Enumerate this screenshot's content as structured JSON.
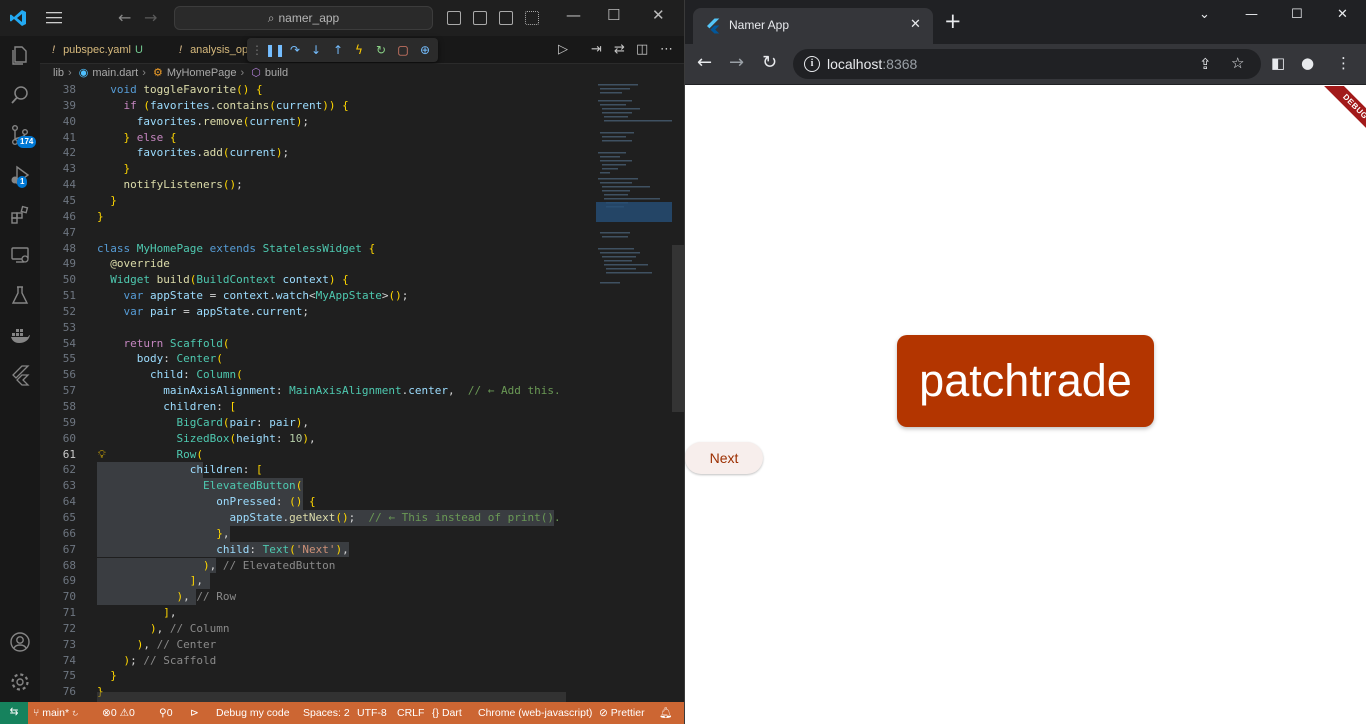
{
  "vscode": {
    "search_text": "namer_app",
    "tabs": [
      {
        "label": "pubspec.yaml",
        "status": "U"
      },
      {
        "label": "analysis_op"
      }
    ],
    "activity_badges": {
      "source_control": "174",
      "run_debug": "1"
    },
    "breadcrumb": [
      "lib",
      "main.dart",
      "MyHomePage",
      "build"
    ],
    "editor": {
      "active_line": 61,
      "code_lines": [
        {
          "num": "38",
          "text": "  void toggleFavorite() {"
        },
        {
          "num": "39",
          "text": "    if (favorites.contains(current)) {"
        },
        {
          "num": "40",
          "text": "      favorites.remove(current);"
        },
        {
          "num": "41",
          "text": "    } else {"
        },
        {
          "num": "42",
          "text": "      favorites.add(current);"
        },
        {
          "num": "43",
          "text": "    }"
        },
        {
          "num": "44",
          "text": "    notifyListeners();"
        },
        {
          "num": "45",
          "text": "  }"
        },
        {
          "num": "46",
          "text": "}"
        },
        {
          "num": "47",
          "text": ""
        },
        {
          "num": "48",
          "text": "class MyHomePage extends StatelessWidget {"
        },
        {
          "num": "49",
          "text": "  @override"
        },
        {
          "num": "50",
          "text": "  Widget build(BuildContext context) {"
        },
        {
          "num": "51",
          "text": "    var appState = context.watch<MyAppState>();"
        },
        {
          "num": "52",
          "text": "    var pair = appState.current;"
        },
        {
          "num": "53",
          "text": ""
        },
        {
          "num": "54",
          "text": "    return Scaffold("
        },
        {
          "num": "55",
          "text": "      body: Center("
        },
        {
          "num": "56",
          "text": "        child: Column("
        },
        {
          "num": "57",
          "text": "          mainAxisAlignment: MainAxisAlignment.center,  // ← Add this."
        },
        {
          "num": "58",
          "text": "          children: ["
        },
        {
          "num": "59",
          "text": "            BigCard(pair: pair),"
        },
        {
          "num": "60",
          "text": "            SizedBox(height: 10),"
        },
        {
          "num": "61",
          "text": "            Row("
        },
        {
          "num": "62",
          "text": "              children: ["
        },
        {
          "num": "63",
          "text": "                ElevatedButton("
        },
        {
          "num": "64",
          "text": "                  onPressed: () {"
        },
        {
          "num": "65",
          "text": "                    appState.getNext();  // ← This instead of print()."
        },
        {
          "num": "66",
          "text": "                  },"
        },
        {
          "num": "67",
          "text": "                  child: Text('Next'),"
        },
        {
          "num": "68",
          "text": "                ), // ElevatedButton"
        },
        {
          "num": "69",
          "text": "              ],"
        },
        {
          "num": "70",
          "text": "            ), // Row"
        },
        {
          "num": "71",
          "text": "          ],"
        },
        {
          "num": "72",
          "text": "        ), // Column"
        },
        {
          "num": "73",
          "text": "      ), // Center"
        },
        {
          "num": "74",
          "text": "    ); // Scaffold"
        },
        {
          "num": "75",
          "text": "  }"
        },
        {
          "num": "76",
          "text": "}"
        }
      ]
    },
    "statusbar": {
      "branch": "main*",
      "errors": "0",
      "warnings": "0",
      "ports": "0",
      "debug": "Debug my code",
      "spaces": "Spaces: 2",
      "encoding": "UTF-8",
      "eol": "CRLF",
      "language": "Dart",
      "device": "Chrome (web-javascript)",
      "formatter": "Prettier"
    },
    "colors": {
      "statusbar": "#cc6633",
      "accent": "#0078d4"
    }
  },
  "chrome": {
    "tab_title": "Namer App",
    "url_host": "localhost",
    "url_port": ":8368",
    "app": {
      "debug_banner": "DEBUG",
      "word_pair": "patchtrade",
      "next_button_label": "Next",
      "card_color": "#b33500"
    }
  }
}
